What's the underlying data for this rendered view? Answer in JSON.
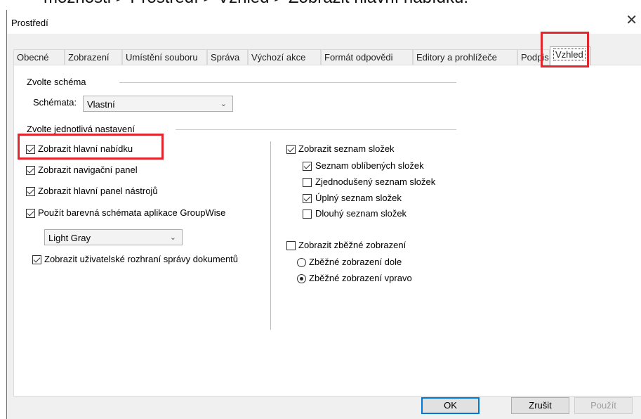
{
  "caption": "možnosti > Prostředí > Vzhled > Zobrazit hlavní nabídku.",
  "dialog": {
    "title": "Prostředí",
    "close_glyph": "✕"
  },
  "tabs": [
    {
      "label": "Obecné",
      "active": false
    },
    {
      "label": "Zobrazení",
      "active": false
    },
    {
      "label": "Umístění souboru",
      "active": false
    },
    {
      "label": "Správa",
      "active": false
    },
    {
      "label": "Výchozí akce",
      "active": false
    },
    {
      "label": "Formát odpovědi",
      "active": false
    },
    {
      "label": "Editory a prohlížeče",
      "active": false
    },
    {
      "label": "Podpis",
      "active": false
    },
    {
      "label": "Vzhled",
      "active": true
    }
  ],
  "scheme": {
    "group_label": "Zvolte schéma",
    "schemes_label": "Schémata:",
    "schemes_value": "Vlastní"
  },
  "settings": {
    "group_label": "Zvolte jednotlivá nastavení",
    "show_main_menu": {
      "label": "Zobrazit hlavní nabídku",
      "checked": true
    },
    "show_nav_panel": {
      "label": "Zobrazit navigační panel",
      "checked": true
    },
    "show_toolbar": {
      "label": "Zobrazit hlavní panel nástrojů",
      "checked": true
    },
    "use_color_schemes": {
      "label": "Použít barevná schémata aplikace GroupWise",
      "checked": true
    },
    "color_scheme_value": "Light Gray",
    "show_doc_mgmt_ui": {
      "label": "Zobrazit uživatelské rozhraní správy dokumentů",
      "checked": true
    },
    "show_folder_list": {
      "label": "Zobrazit seznam složek",
      "checked": true
    },
    "favorite_folders": {
      "label": "Seznam oblíbených složek",
      "checked": true
    },
    "simplified_folders": {
      "label": "Zjednodušený seznam složek",
      "checked": false
    },
    "full_folders": {
      "label": "Úplný seznam složek",
      "checked": true
    },
    "long_folders": {
      "label": "Dlouhý seznam složek",
      "checked": false
    },
    "show_quick_view": {
      "label": "Zobrazit zběžné zobrazení",
      "checked": false
    },
    "quick_view_bottom": {
      "label": "Zběžné zobrazení dole",
      "checked": false
    },
    "quick_view_right": {
      "label": "Zběžné zobrazení vpravo",
      "checked": true
    }
  },
  "buttons": {
    "ok": "OK",
    "cancel": "Zrušit",
    "apply": "Použít"
  },
  "colors": {
    "highlight": "#e1262d",
    "default_button_border": "#0078d7"
  }
}
